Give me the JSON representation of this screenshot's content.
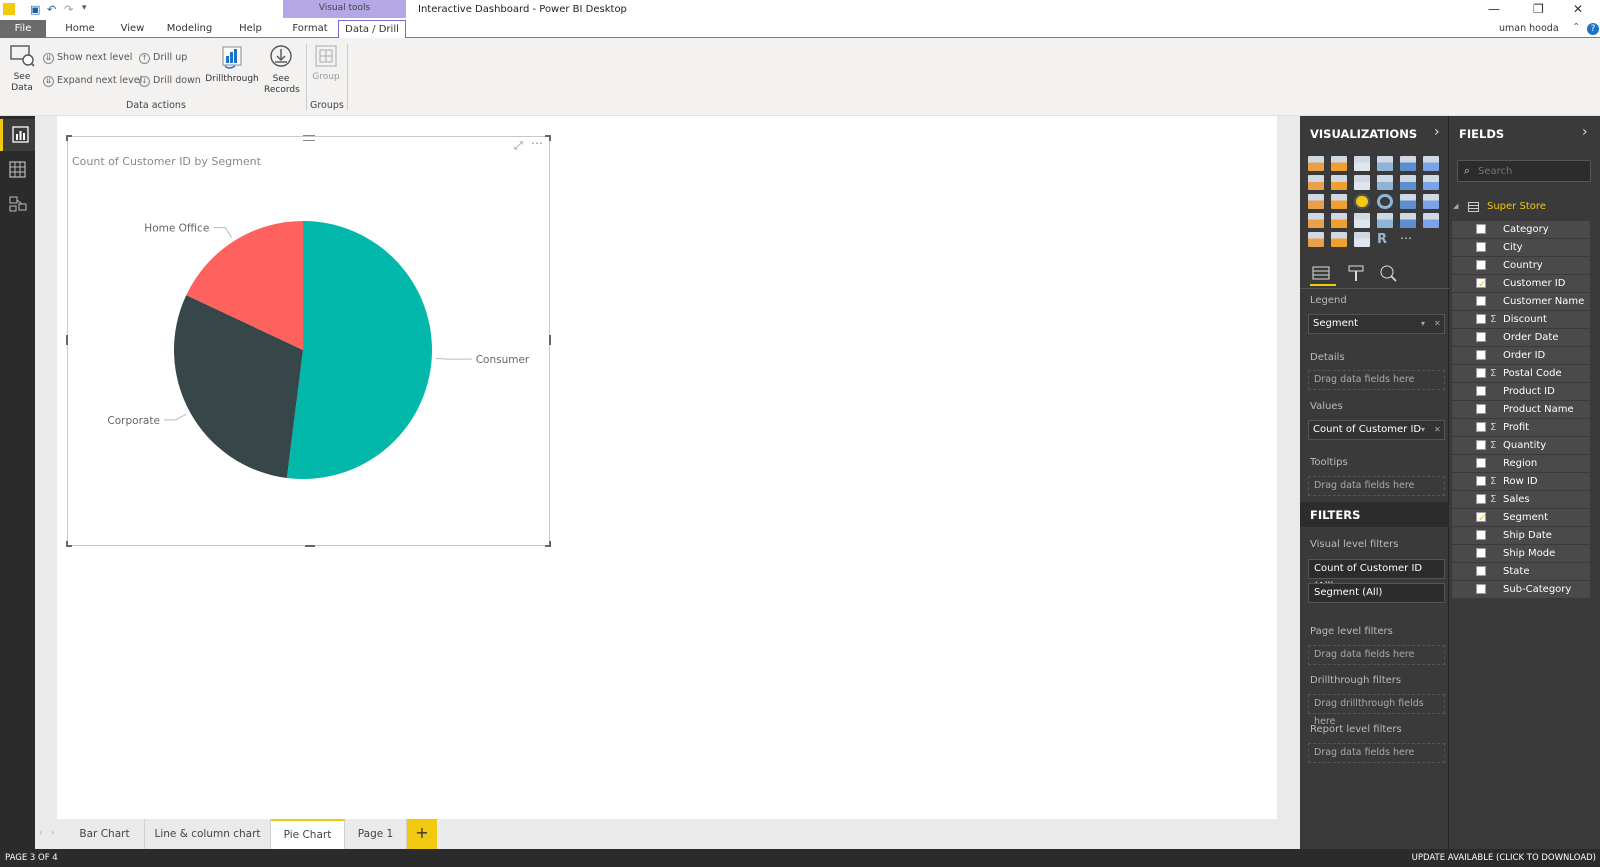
{
  "window": {
    "contextual_tab_group": "Visual tools",
    "title": "Interactive Dashboard - Power BI Desktop",
    "user": "uman hooda"
  },
  "tabs": [
    "File",
    "Home",
    "View",
    "Modeling",
    "Help",
    "Format",
    "Data / Drill"
  ],
  "ribbon": {
    "see_data": "See\nData",
    "show_next_level": "Show next level",
    "expand_next_level": "Expand next level",
    "drill_up": "Drill up",
    "drill_down": "Drill down",
    "drillthrough": "Drillthrough",
    "see_records": "See\nRecords",
    "group": "Group",
    "group_data_actions": "Data actions",
    "group_groups": "Groups"
  },
  "visual": {
    "title": "Count of Customer ID by Segment"
  },
  "chart_data": {
    "type": "pie",
    "title": "Count of Customer ID by Segment",
    "categories": [
      "Consumer",
      "Corporate",
      "Home Office"
    ],
    "values": [
      52,
      30,
      18
    ],
    "colors": [
      "#01b8aa",
      "#374649",
      "#fd625e"
    ]
  },
  "page_tabs": [
    "Bar Chart",
    "Line & column chart",
    "Pie Chart",
    "Page 1"
  ],
  "active_page": "Pie Chart",
  "add_page": "+",
  "status": {
    "page": "PAGE 3 OF 4",
    "update": "UPDATE AVAILABLE (CLICK TO DOWNLOAD)"
  },
  "viz_pane": {
    "title": "VISUALIZATIONS",
    "legend_label": "Legend",
    "legend_value": "Segment",
    "details_label": "Details",
    "details_drop": "Drag data fields here",
    "values_label": "Values",
    "values_value": "Count of Customer ID",
    "tooltips_label": "Tooltips",
    "tooltips_drop": "Drag data fields here",
    "filters_title": "FILTERS",
    "visual_filters_label": "Visual level filters",
    "filter1": "Count of Customer ID (All)",
    "filter2": "Segment  (All)",
    "page_filters_label": "Page level filters",
    "page_filters_drop": "Drag data fields here",
    "drill_filters_label": "Drillthrough filters",
    "drill_filters_drop": "Drag drillthrough fields here",
    "report_filters_label": "Report level filters",
    "report_filters_drop": "Drag data fields here"
  },
  "fields_pane": {
    "title": "FIELDS",
    "search_placeholder": "Search",
    "table": "Super Store",
    "fields": [
      {
        "name": "Category",
        "sigma": false,
        "checked": false
      },
      {
        "name": "City",
        "sigma": false,
        "checked": false
      },
      {
        "name": "Country",
        "sigma": false,
        "checked": false
      },
      {
        "name": "Customer ID",
        "sigma": false,
        "checked": true
      },
      {
        "name": "Customer Name",
        "sigma": false,
        "checked": false
      },
      {
        "name": "Discount",
        "sigma": true,
        "checked": false
      },
      {
        "name": "Order Date",
        "sigma": false,
        "checked": false
      },
      {
        "name": "Order ID",
        "sigma": false,
        "checked": false
      },
      {
        "name": "Postal Code",
        "sigma": true,
        "checked": false
      },
      {
        "name": "Product ID",
        "sigma": false,
        "checked": false
      },
      {
        "name": "Product Name",
        "sigma": false,
        "checked": false
      },
      {
        "name": "Profit",
        "sigma": true,
        "checked": false
      },
      {
        "name": "Quantity",
        "sigma": true,
        "checked": false
      },
      {
        "name": "Region",
        "sigma": false,
        "checked": false
      },
      {
        "name": "Row ID",
        "sigma": true,
        "checked": false
      },
      {
        "name": "Sales",
        "sigma": true,
        "checked": false
      },
      {
        "name": "Segment",
        "sigma": false,
        "checked": true
      },
      {
        "name": "Ship Date",
        "sigma": false,
        "checked": false
      },
      {
        "name": "Ship Mode",
        "sigma": false,
        "checked": false
      },
      {
        "name": "State",
        "sigma": false,
        "checked": false
      },
      {
        "name": "Sub-Category",
        "sigma": false,
        "checked": false
      }
    ]
  },
  "colors": {
    "accent": "#f2c811",
    "contextual": "#b4a7e5",
    "pane_bg": "#3a3a3a"
  }
}
